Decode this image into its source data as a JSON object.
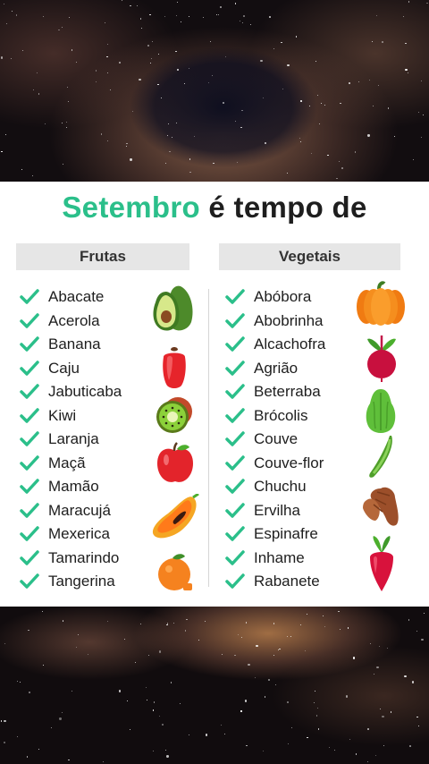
{
  "title": {
    "highlight": "Setembro",
    "rest": " é tempo de"
  },
  "fruits": {
    "header": "Frutas",
    "items": [
      "Abacate",
      "Acerola",
      "Banana",
      "Caju",
      "Jabuticaba",
      "Kiwi",
      "Laranja",
      "Maçã",
      "Mamão",
      "Maracujá",
      "Mexerica",
      "Tamarindo",
      "Tangerina"
    ]
  },
  "vegetables": {
    "header": "Vegetais",
    "items": [
      "Abóbora",
      "Abobrinha",
      "Alcachofra",
      "Agrião",
      "Beterraba",
      "Brócolis",
      "Couve",
      "Couve-flor",
      "Chuchu",
      "Ervilha",
      "Espinafre",
      "Inhame",
      "Rabanete"
    ]
  },
  "colors": {
    "accent": "#2bbf8a",
    "check": "#2bbf8a",
    "header_bg": "#e6e6e6"
  },
  "icons": {
    "fruits": [
      "avocado-icon",
      "cashew-icon",
      "kiwi-icon",
      "apple-icon",
      "papaya-icon",
      "orange-icon"
    ],
    "vegetables": [
      "pumpkin-icon",
      "beet-icon",
      "chayote-icon",
      "pea-pod-icon",
      "yam-icon",
      "radish-icon"
    ]
  }
}
